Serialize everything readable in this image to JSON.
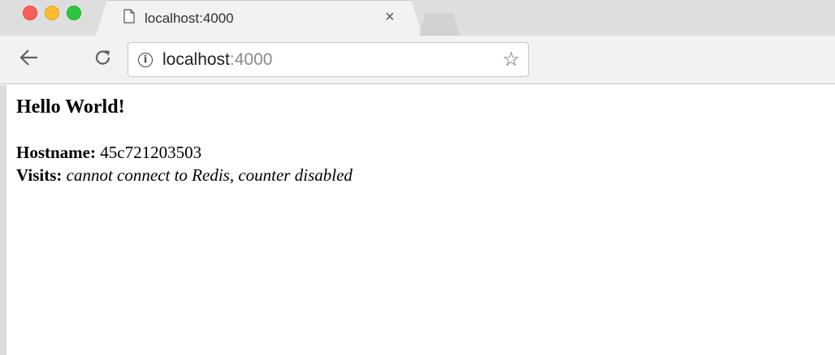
{
  "browser": {
    "tab": {
      "title": "localhost:4000",
      "close_icon": "×"
    },
    "address": {
      "host": "localhost",
      "port": ":4000"
    }
  },
  "page": {
    "heading": "Hello World!",
    "hostname_label": "Hostname:",
    "hostname_value": "45c721203503",
    "visits_label": "Visits:",
    "visits_value": "cannot connect to Redis, counter disabled"
  }
}
